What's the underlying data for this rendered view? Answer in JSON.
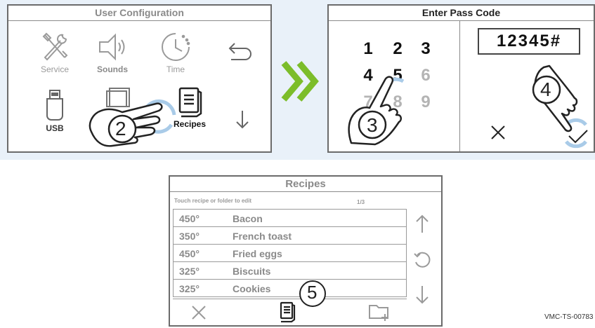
{
  "config_panel": {
    "title": "User Configuration",
    "items": [
      {
        "label": "Service",
        "icon": "wrench-screwdriver-icon"
      },
      {
        "label": "Sounds",
        "icon": "speaker-icon"
      },
      {
        "label": "Time",
        "icon": "clock-icon"
      },
      {
        "label": "USB",
        "icon": "usb-drive-icon"
      },
      {
        "label": "Recipes",
        "icon": "recipe-book-icon"
      }
    ],
    "back_icon": "back-arrow-icon",
    "down_icon": "down-arrow-icon",
    "step_marker": "2"
  },
  "arrow_icon": "double-chevron-right-icon",
  "pass_panel": {
    "title": "Enter Pass Code",
    "keys": [
      "1",
      "2",
      "3",
      "4",
      "5",
      "6",
      "7",
      "8",
      "9"
    ],
    "code_value": "12345#",
    "cancel_icon": "close-icon",
    "confirm_icon": "checkmark-icon",
    "step_marker_keypad": "3",
    "step_marker_confirm": "4"
  },
  "recipes_panel": {
    "title": "Recipes",
    "hint": "Touch recipe or folder to edit",
    "page": "1/3",
    "rows": [
      {
        "temp": "450°",
        "name": "Bacon"
      },
      {
        "temp": "350°",
        "name": "French toast"
      },
      {
        "temp": "450°",
        "name": "Fried eggs"
      },
      {
        "temp": "325°",
        "name": "Biscuits"
      },
      {
        "temp": "325°",
        "name": "Cookies"
      }
    ],
    "step_marker": "5"
  },
  "doc_code": "VMC-TS-00783",
  "colors": {
    "accent_green": "#7cbd2a",
    "touch_ring": "#a9cbe8",
    "panel_strip": "#e9f1f9"
  }
}
